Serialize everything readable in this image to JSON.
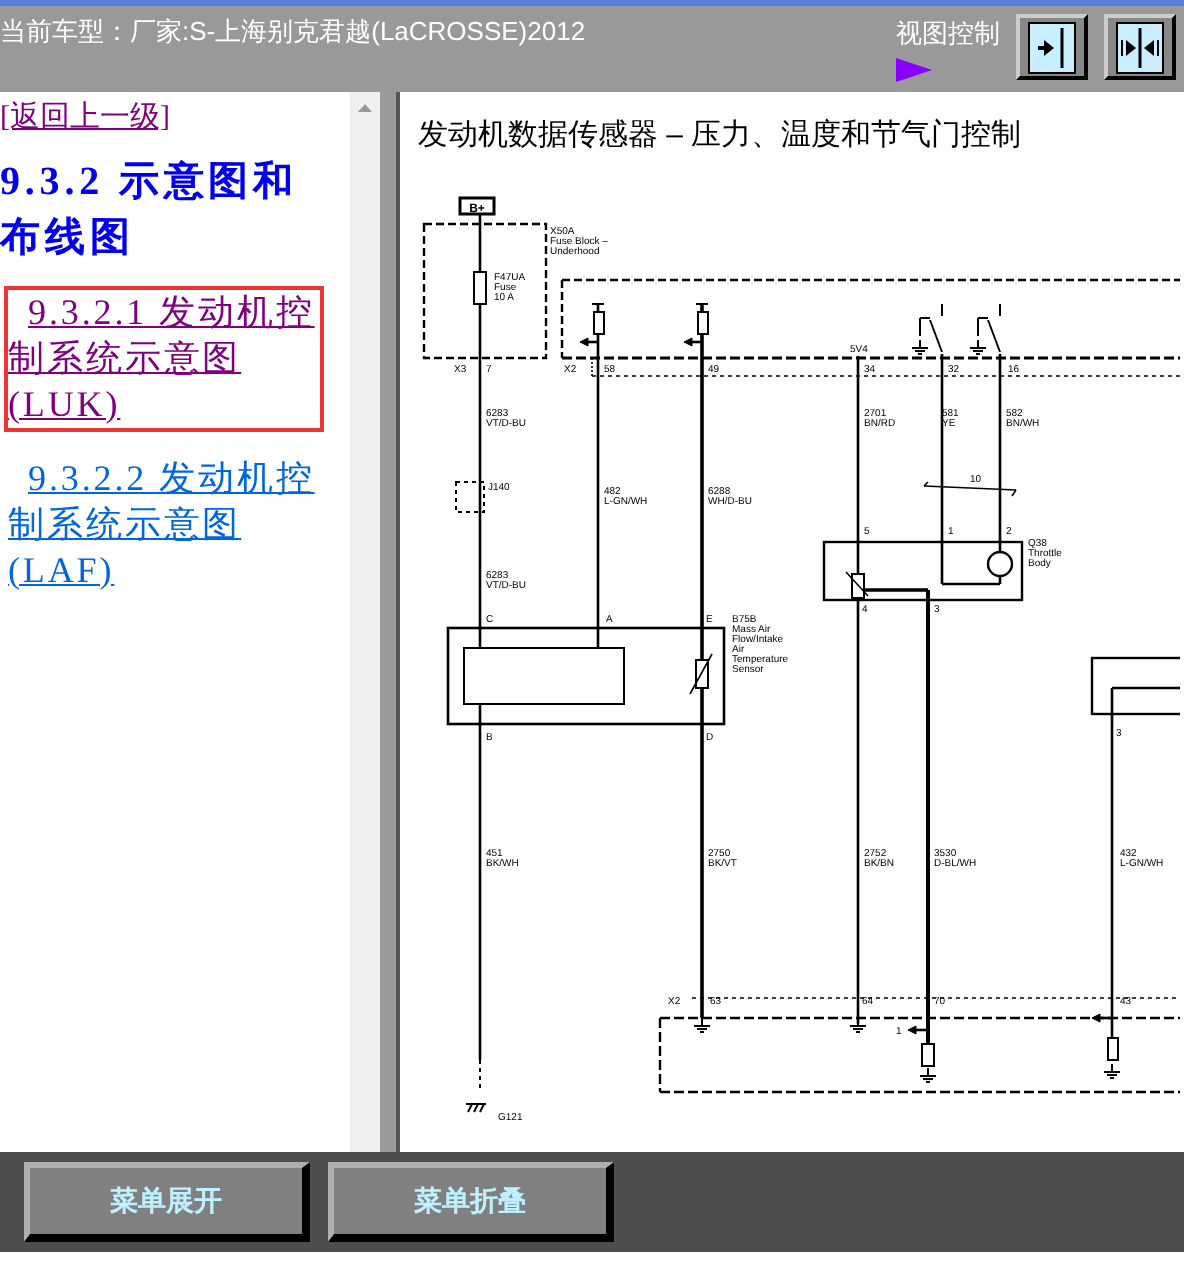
{
  "header": {
    "vehicle": "当前车型：厂家:S-上海别克君越(LaCROSSE)2012",
    "view_control": "视图控制"
  },
  "sidebar": {
    "back_link": "[返回上一级]",
    "section": "9.3.2 示意图和布线图",
    "items": [
      {
        "label": "9.3.2.1 发动机控制系统示意图(LUK)",
        "selected": true
      },
      {
        "label": "9.3.2.2 发动机控制系统示意图(LAF)",
        "selected": false
      }
    ]
  },
  "diagram": {
    "title": "发动机数据传感器 – 压力、温度和节气门控制",
    "labels": [
      "B+",
      "X50A",
      "Fuse Block –",
      "Underhood",
      "F47UA",
      "Fuse",
      "10 A",
      "X3",
      "7",
      "X2",
      "58",
      "49",
      "5V4",
      "34",
      "32",
      "16",
      "6283",
      "VT/D-BU",
      "2701",
      "BN/RD",
      "581",
      "YE",
      "582",
      "BN/WH",
      "J140",
      "482",
      "L-GN/WH",
      "6288",
      "WH/D-BU",
      "10",
      "5",
      "1",
      "2",
      "Q38",
      "Throttle",
      "Body",
      "6283",
      "VT/D-BU",
      "4",
      "3",
      "C",
      "A",
      "E",
      "B75B",
      "Mass Air",
      "Flow/Intake",
      "Air",
      "Temperature",
      "Sensor",
      "B",
      "D",
      "3",
      "451",
      "BK/WH",
      "2750",
      "BK/VT",
      "2752",
      "BK/BN",
      "3530",
      "D-BL/WH",
      "432",
      "L-GN/WH",
      "X2",
      "63",
      "64",
      "70",
      "43",
      "1",
      "G121"
    ]
  },
  "buttons": [
    "菜单展开",
    "菜单折叠"
  ]
}
